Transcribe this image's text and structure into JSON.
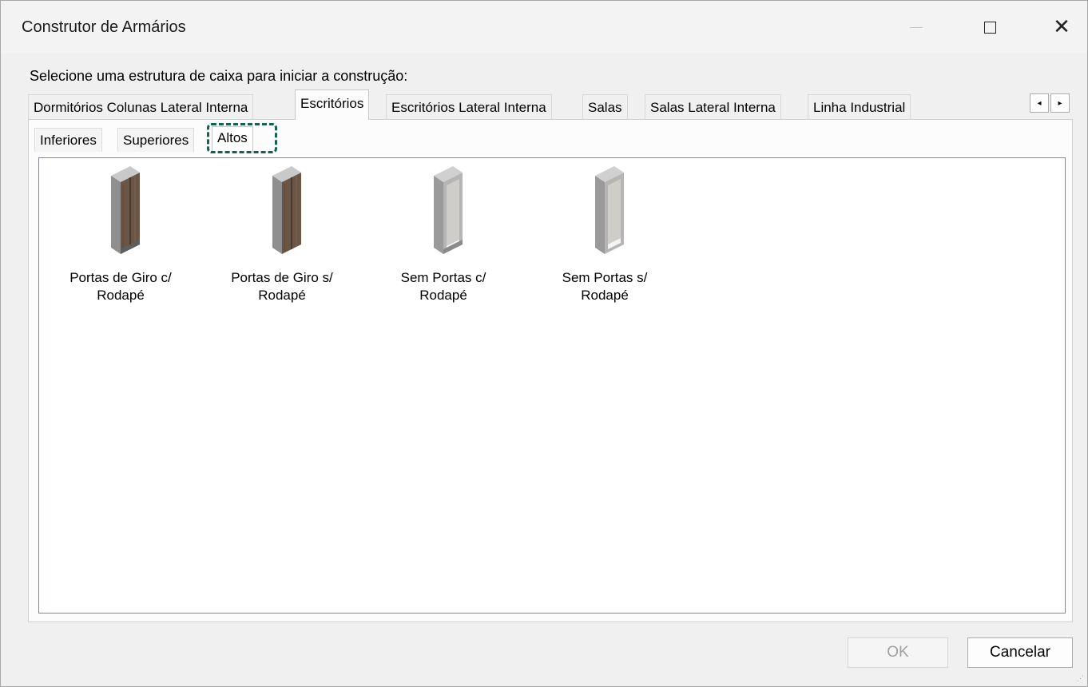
{
  "window": {
    "title": "Construtor de Armários"
  },
  "instruction": "Selecione uma estrutura de caixa para iniciar a construção:",
  "main_tabs": [
    {
      "label": "Dormitórios Colunas Lateral Interna"
    },
    {
      "label": "Escritórios",
      "selected": true
    },
    {
      "label": "Escritórios Lateral Interna"
    },
    {
      "label": "Salas"
    },
    {
      "label": "Salas Lateral Interna"
    },
    {
      "label": "Linha Industrial"
    }
  ],
  "tab_scroll": {
    "left": "◂",
    "right": "▸"
  },
  "sub_tabs": [
    {
      "label": "Inferiores"
    },
    {
      "label": "Superiores"
    },
    {
      "label": "Altos",
      "selected": true
    }
  ],
  "items": [
    {
      "label": "Portas de Giro c/\nRodapé",
      "icon": "cabinet-wood-doors-plinth-icon"
    },
    {
      "label": "Portas de Giro s/\nRodapé",
      "icon": "cabinet-wood-doors-icon"
    },
    {
      "label": "Sem Portas c/\nRodapé",
      "icon": "cabinet-open-plinth-icon"
    },
    {
      "label": "Sem Portas s/\nRodapé",
      "icon": "cabinet-open-icon"
    }
  ],
  "buttons": {
    "ok": "OK",
    "cancel": "Cancelar"
  },
  "colors": {
    "highlight": "#15614f",
    "wood": "#6b5646"
  }
}
